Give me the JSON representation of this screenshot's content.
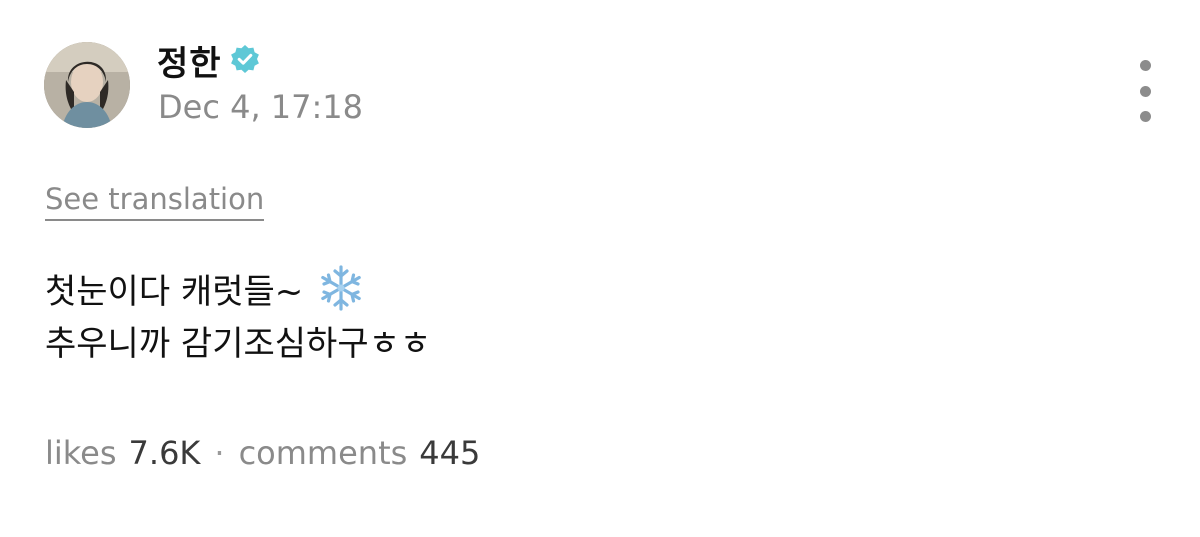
{
  "post": {
    "author_name": "정한",
    "verified_badge": "verified-icon",
    "timestamp": "Dec 4, 17:18",
    "see_translation": "See translation",
    "body_lines": [
      "첫눈이다 캐럿들~",
      "추우니까 감기조심하구ㅎㅎ"
    ],
    "body_emoji": "snowflake-icon",
    "stats": {
      "likes_label": "likes",
      "likes_value": "7.6K",
      "separator": "·",
      "comments_label": "comments",
      "comments_value": "445"
    }
  },
  "colors": {
    "verified_badge": "#5ec8d6",
    "muted_text": "#8a8a8a",
    "primary_text": "#111111"
  }
}
